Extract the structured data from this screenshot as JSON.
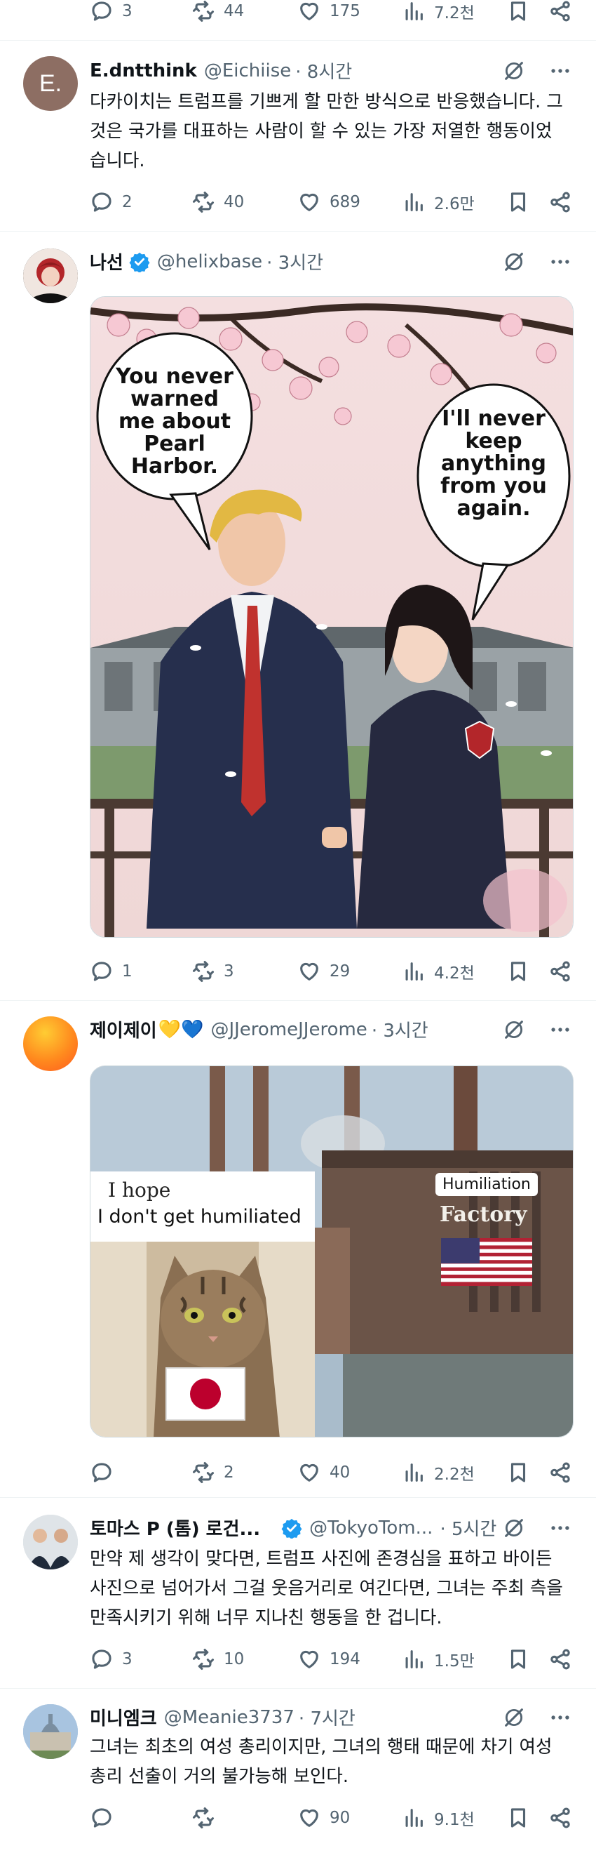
{
  "top_bar": {
    "reply": "3",
    "retweet": "44",
    "like": "175",
    "views": "7.2천"
  },
  "tweets": [
    {
      "avatar_letter": "E.",
      "name": "E.dntthink",
      "handle": "@Eichiise",
      "time": "· 8시간",
      "text": "다카이치는 트럼프를 기쁘게 할 만한 방식으로 반응했습니다. 그것은 국가를 대표하는 사람이 할 수 있는 가장 저열한 행동이었습니다.",
      "reply": "2",
      "retweet": "40",
      "like": "689",
      "views": "2.6만"
    },
    {
      "name": "나선",
      "handle": "@helixbase",
      "time": "· 3시간",
      "bubble_left": "You never warned me about Pearl Harbor.",
      "bubble_right": "I'll never keep anything from you again.",
      "reply": "1",
      "retweet": "3",
      "like": "29",
      "views": "4.2천"
    },
    {
      "name": "제이제이",
      "name_hearts": "💛💙",
      "handle": "@JJeromeJJerome",
      "time": "· 3시간",
      "meme_left": "I hope\nI don't get humiliated",
      "meme_left_1": "I hope",
      "meme_left_2": "I don't get humiliated",
      "meme_right_1": "Humiliation",
      "meme_right_2": "Factory",
      "reply": "",
      "retweet": "2",
      "like": "40",
      "views": "2.2천"
    },
    {
      "name": "토마스 P (톰) 로건...",
      "handle": "@TokyoTom...",
      "time": "· 5시간",
      "text": "만약 제 생각이 맞다면, 트럼프 사진에 존경심을 표하고 바이든 사진으로 넘어가서 그걸 웃음거리로 여긴다면, 그녀는 주최 측을 만족시키기 위해 너무 지나친 행동을 한 겁니다.",
      "reply": "3",
      "retweet": "10",
      "like": "194",
      "views": "1.5만"
    },
    {
      "name": "미니엠크",
      "handle": "@Meanie3737",
      "time": "· 7시간",
      "text": "그녀는 최초의 여성 총리이지만, 그녀의 행태 때문에 차기 여성 총리 선출이 거의 불가능해 보인다.",
      "reply": "",
      "retweet": "",
      "like": "90",
      "views": "9.1천"
    }
  ],
  "colors": {
    "verified": "#1d9bf0",
    "muted": "#536471",
    "text": "#0f1419",
    "divider": "#eff3f4"
  },
  "icons": [
    "reply-icon",
    "retweet-icon",
    "like-icon",
    "views-icon",
    "bookmark-icon",
    "share-icon",
    "grok-icon",
    "more-icon",
    "verified-badge-icon"
  ]
}
